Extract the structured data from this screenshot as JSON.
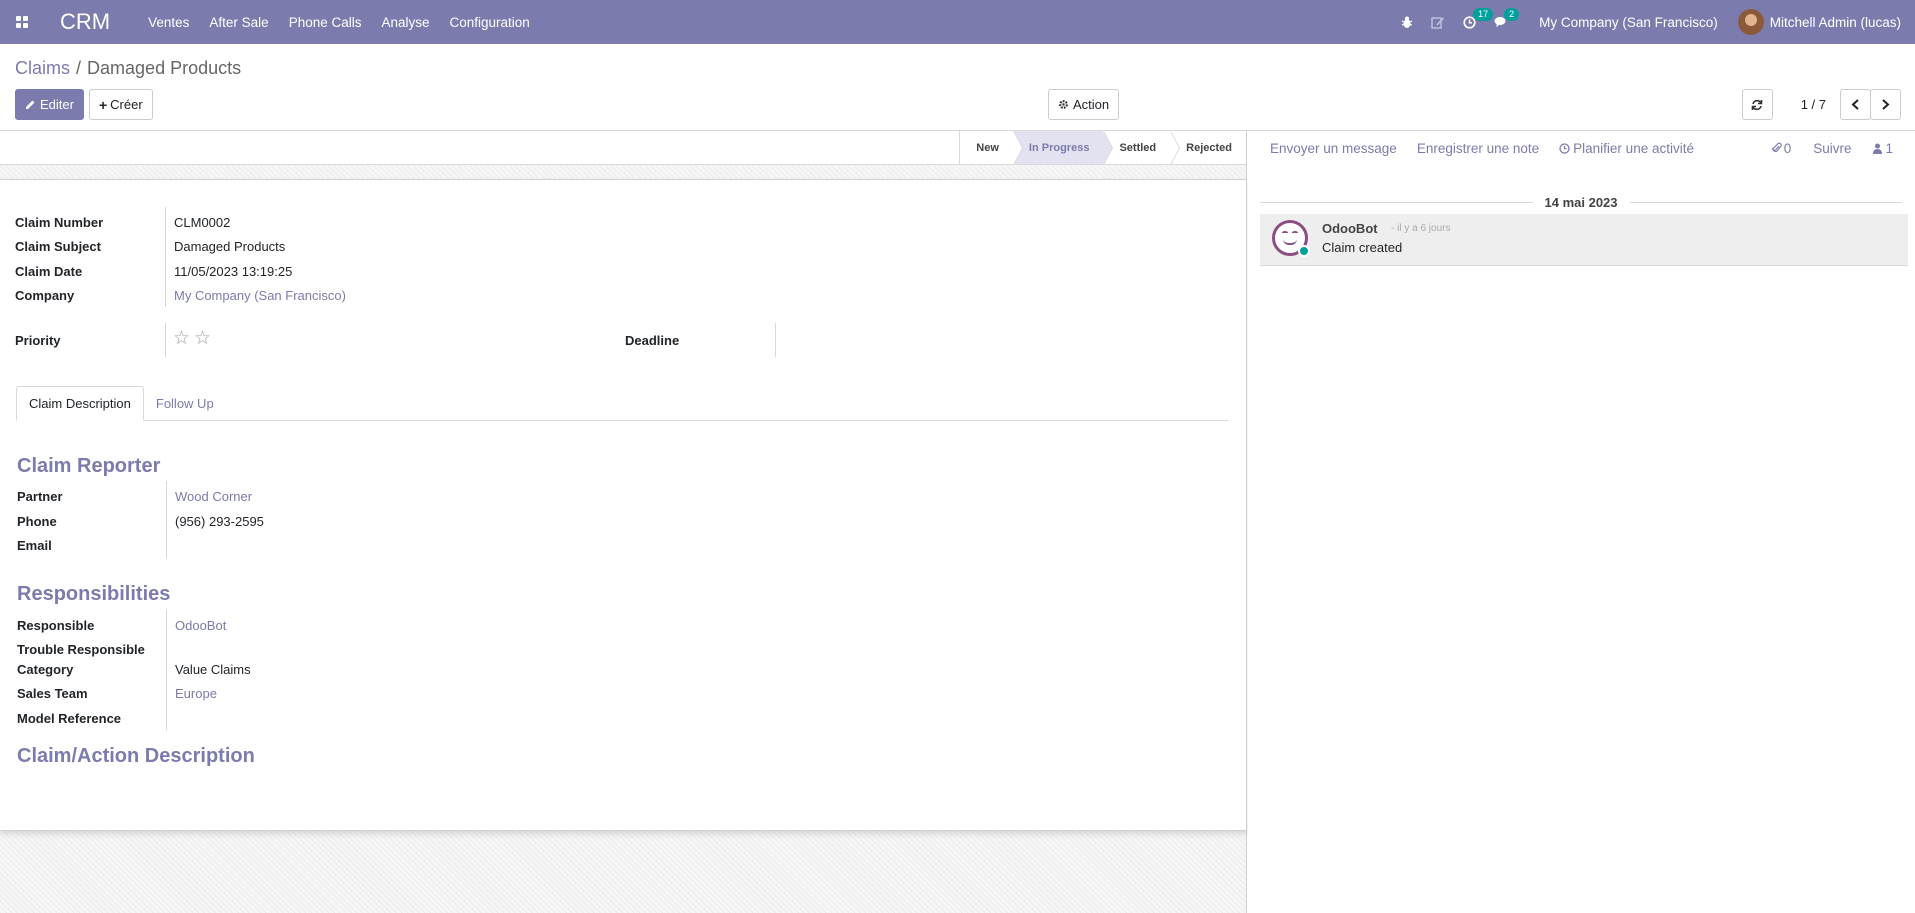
{
  "navbar": {
    "app_name": "CRM",
    "menu": [
      "Ventes",
      "After Sale",
      "Phone Calls",
      "Analyse",
      "Configuration"
    ],
    "activity_count": "17",
    "message_count": "2",
    "company": "My Company (San Francisco)",
    "user": "Mitchell Admin (lucas)"
  },
  "breadcrumb": {
    "parent": "Claims",
    "separator": "/",
    "current": "Damaged Products"
  },
  "toolbar": {
    "edit_label": "Editer",
    "create_label": "Créer",
    "action_label": "Action",
    "pager_value": "1 / 7"
  },
  "statusbar": {
    "stages": [
      "New",
      "In Progress",
      "Settled",
      "Rejected"
    ],
    "active_stage": "In Progress"
  },
  "form": {
    "claim_number_label": "Claim Number",
    "claim_number": "CLM0002",
    "claim_subject_label": "Claim Subject",
    "claim_subject": "Damaged Products",
    "claim_date_label": "Claim Date",
    "claim_date": "11/05/2023 13:19:25",
    "company_label": "Company",
    "company": "My Company (San Francisco)",
    "priority_label": "Priority",
    "deadline_label": "Deadline",
    "priority_stars": 0,
    "priority_max": 2
  },
  "tabs": [
    "Claim Description",
    "Follow Up"
  ],
  "reporter": {
    "title": "Claim Reporter",
    "partner_label": "Partner",
    "partner": "Wood Corner",
    "phone_label": "Phone",
    "phone": "(956) 293-2595",
    "email_label": "Email"
  },
  "responsibilities": {
    "title": "Responsibilities",
    "responsible_label": "Responsible",
    "responsible": "OdooBot",
    "trouble_label": "Trouble Responsible",
    "category_label": "Category",
    "category": "Value Claims",
    "team_label": "Sales Team",
    "team": "Europe",
    "model_label": "Model Reference"
  },
  "claim_action": {
    "title": "Claim/Action Description"
  },
  "chatter": {
    "send_message": "Envoyer un message",
    "log_note": "Enregistrer une note",
    "schedule_activity": "Planifier une activité",
    "attachments": "0",
    "follow": "Suivre",
    "followers": "1",
    "date": "14 mai 2023",
    "message": {
      "author": "OdooBot",
      "time": "- il y a 6 jours",
      "body": "Claim created"
    }
  },
  "colors": {
    "brand": "#7c7bad",
    "badge": "#00a09d"
  }
}
